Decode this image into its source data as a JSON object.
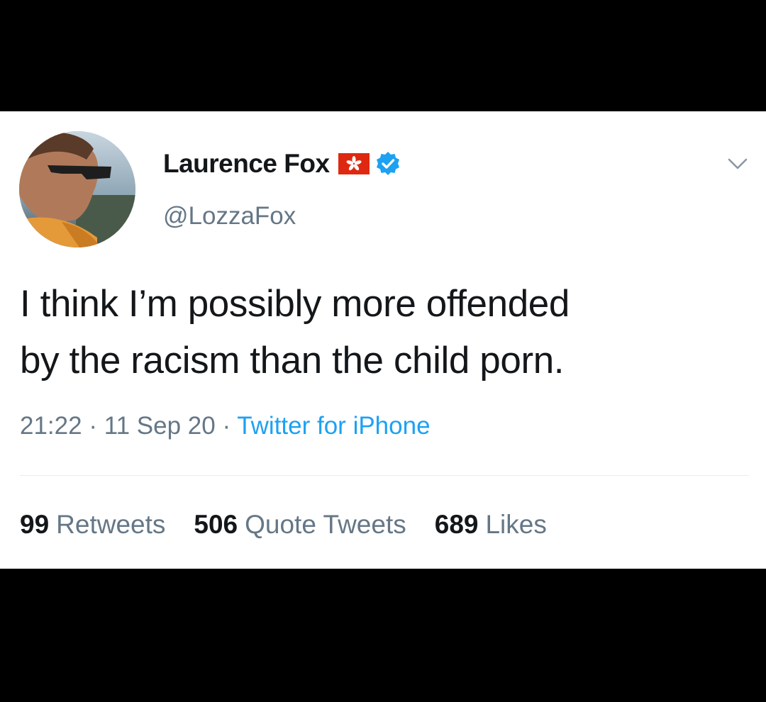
{
  "tweet": {
    "display_name": "Laurence Fox",
    "handle": "@LozzaFox",
    "text_lines": [
      "I think I’m possibly more offended",
      "by the racism than the child porn."
    ],
    "time": "21:22",
    "separator": "·",
    "date": "11 Sep 20",
    "source": "Twitter for iPhone",
    "stats": {
      "retweets_count": "99",
      "retweets_label": "Retweets",
      "quotes_count": "506",
      "quotes_label": "Quote Tweets",
      "likes_count": "689",
      "likes_label": "Likes"
    }
  },
  "icons": {
    "flag": "hong-kong-flag-icon",
    "verified": "verified-badge-icon",
    "menu": "chevron-down-icon"
  },
  "colors": {
    "background": "#000000",
    "card": "#ffffff",
    "text_primary": "#14171a",
    "text_secondary": "#657786",
    "accent": "#1da1f2",
    "flag_red": "#de2910"
  }
}
